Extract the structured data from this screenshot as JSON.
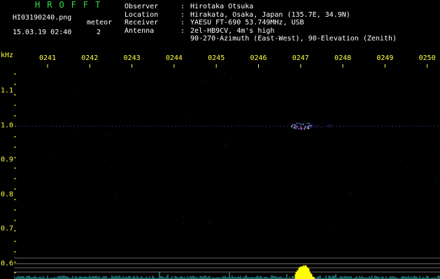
{
  "header": {
    "brand": "HROFFT",
    "filename": "HI03190240.png",
    "meteor_label": "meteor",
    "meteor_count": "2",
    "datetime": "15.03.19 02:40"
  },
  "station_info": [
    {
      "label": "Observer",
      "value": "Hirotaka Otsuka"
    },
    {
      "label": "Location",
      "value": "Hirakata, Osaka, Japan (135.7E, 34.9N)"
    },
    {
      "label": "Receiver",
      "value": "YAESU FT-690 53.749MHz, USB"
    },
    {
      "label": "Antenna",
      "value": "2el-HB9CV, 4m's high"
    },
    {
      "label": "",
      "value": "90-270-Azimuth (East-West), 90-Elevation (Zenith)"
    }
  ],
  "axes": {
    "freq_unit": "kHz",
    "time_ticks": [
      "0241",
      "0242",
      "0243",
      "0244",
      "0245",
      "0246",
      "0247",
      "0248",
      "0249",
      "0250"
    ],
    "freq_ticks": [
      "1.1",
      "1.0",
      "0.9",
      "0.8",
      "0.7",
      "0.6"
    ]
  },
  "colors": {
    "background": "#000000",
    "labels": "#ffff40",
    "brand": "#2fe04a",
    "text": "#ffffff",
    "trace": "#e050e0",
    "level": "#ffff00",
    "noise": "#30d0d0"
  }
}
